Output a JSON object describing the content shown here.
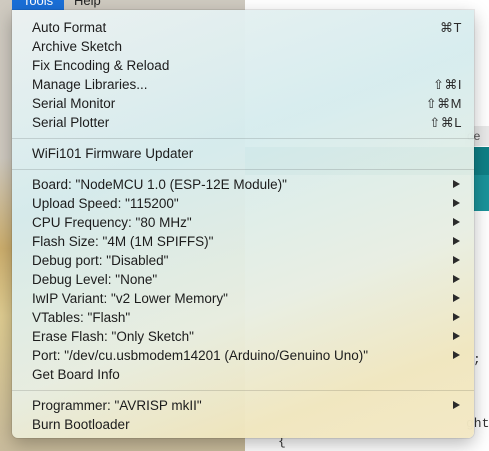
{
  "menubar": {
    "tools": "Tools",
    "help": "Help"
  },
  "background": {
    "tab_label": "de",
    "code_semicolon": ";",
    "code_text": "ght",
    "code_brace": "{"
  },
  "menu": {
    "group1": [
      {
        "label": "Auto Format",
        "shortcut": "⌘T"
      },
      {
        "label": "Archive Sketch",
        "shortcut": ""
      },
      {
        "label": "Fix Encoding & Reload",
        "shortcut": ""
      },
      {
        "label": "Manage Libraries...",
        "shortcut": "⇧⌘I"
      },
      {
        "label": "Serial Monitor",
        "shortcut": "⇧⌘M"
      },
      {
        "label": "Serial Plotter",
        "shortcut": "⇧⌘L"
      }
    ],
    "group2": [
      {
        "label": "WiFi101 Firmware Updater"
      }
    ],
    "group3": [
      {
        "label": "Board: \"NodeMCU 1.0 (ESP-12E Module)\"",
        "submenu": true
      },
      {
        "label": "Upload Speed: \"115200\"",
        "submenu": true
      },
      {
        "label": "CPU Frequency: \"80 MHz\"",
        "submenu": true
      },
      {
        "label": "Flash Size: \"4M (1M SPIFFS)\"",
        "submenu": true
      },
      {
        "label": "Debug port: \"Disabled\"",
        "submenu": true
      },
      {
        "label": "Debug Level: \"None\"",
        "submenu": true
      },
      {
        "label": "IwIP Variant: \"v2 Lower Memory\"",
        "submenu": true
      },
      {
        "label": "VTables: \"Flash\"",
        "submenu": true
      },
      {
        "label": "Erase Flash: \"Only Sketch\"",
        "submenu": true
      },
      {
        "label": "Port: \"/dev/cu.usbmodem14201 (Arduino/Genuino Uno)\"",
        "submenu": true
      },
      {
        "label": "Get Board Info",
        "submenu": false
      }
    ],
    "group4": [
      {
        "label": "Programmer: \"AVRISP mkII\"",
        "submenu": true
      },
      {
        "label": "Burn Bootloader",
        "submenu": false
      }
    ]
  }
}
